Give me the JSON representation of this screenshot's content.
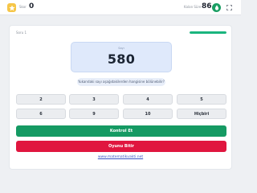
{
  "header": {
    "score_label": "Skor",
    "score_value": "0",
    "time_label": "Kalan Süre",
    "time_value": "86",
    "star_icon": "star-icon",
    "drop_icon": "drop-icon",
    "expand_icon": "expand-icon"
  },
  "question": {
    "counter": "Soru 1",
    "progress": 1.0,
    "number_label": "Sayı",
    "number": "580",
    "prompt": "Yukarıdaki sayı aşağıdakilerden hangisine bölünebilir?"
  },
  "options": [
    "2",
    "3",
    "4",
    "5",
    "6",
    "9",
    "10",
    "Hiçbiri"
  ],
  "actions": {
    "check_label": "Kontrol Et",
    "end_label": "Oyunu Bitir"
  },
  "footer": {
    "site": "www.matematikvakti.net"
  },
  "colors": {
    "star": "#f6c648",
    "accent_green": "#159a63",
    "danger_red": "#e0163f",
    "number_box": "#dfe9fb"
  }
}
